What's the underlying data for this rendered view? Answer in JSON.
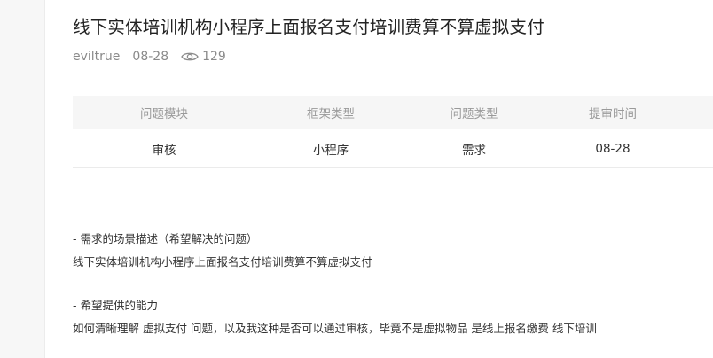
{
  "post": {
    "title": "线下实体培训机构小程序上面报名支付培训费算不算虚拟支付",
    "author": "eviltrue",
    "date": "08-28",
    "views": "129",
    "view_icon": "eye-icon"
  },
  "info_table": {
    "headers": [
      "问题模块",
      "框架类型",
      "问题类型",
      "提审时间"
    ],
    "row": [
      "审核",
      "小程序",
      "需求",
      "08-28"
    ]
  },
  "content": {
    "scene_heading": "- 需求的场景描述（希望解决的问题）",
    "scene_text": "线下实体培训机构小程序上面报名支付培训费算不算虚拟支付",
    "ability_heading": "- 希望提供的能力",
    "ability_text": "如何清晰理解  虚拟支付 问题，以及我这种是否可以通过审核，毕竟不是虚拟物品 是线上报名缴费 线下培训"
  },
  "colors": {
    "title": "#222222",
    "meta": "#8a8a8a",
    "table_header_bg": "#f6f6f6",
    "table_header_text": "#9a9a9a",
    "divider": "#ebebeb"
  }
}
